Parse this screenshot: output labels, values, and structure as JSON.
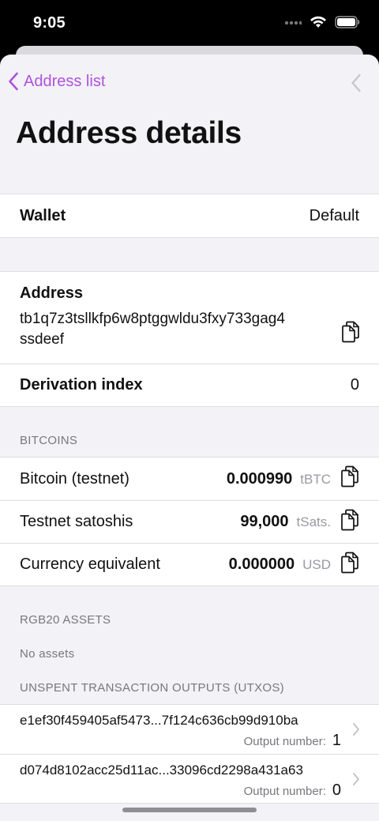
{
  "status_bar": {
    "time": "9:05"
  },
  "nav": {
    "back_label": "Address list"
  },
  "title": "Address details",
  "wallet": {
    "label": "Wallet",
    "value": "Default"
  },
  "address": {
    "label": "Address",
    "value_line1": "tb1q7z3tsllkfp6w8ptggwldu3fxy733gag4",
    "value_line2": "ssdeef"
  },
  "derivation": {
    "label": "Derivation index",
    "value": "0"
  },
  "bitcoins": {
    "header": "BITCOINS",
    "rows": [
      {
        "label": "Bitcoin (testnet)",
        "amount": "0.000990",
        "unit": "tBTC"
      },
      {
        "label": "Testnet satoshis",
        "amount": "99,000",
        "unit": "tSats."
      },
      {
        "label": "Currency equivalent",
        "amount": "0.000000",
        "unit": "USD"
      }
    ]
  },
  "rgb20": {
    "header": "RGB20 ASSETS",
    "empty_text": "No assets"
  },
  "utxos": {
    "header": "UNSPENT TRANSACTION OUTPUTS (UTXOS)",
    "output_label": "Output number:",
    "items": [
      {
        "id": "e1ef30f459405af5473...7f124c636cb99d910ba",
        "output": "1"
      },
      {
        "id": "d074d8102acc25d11ac...33096cd2298a431a63",
        "output": "0"
      }
    ]
  },
  "colors": {
    "accent": "#af52de",
    "background": "#f2f2f7"
  }
}
